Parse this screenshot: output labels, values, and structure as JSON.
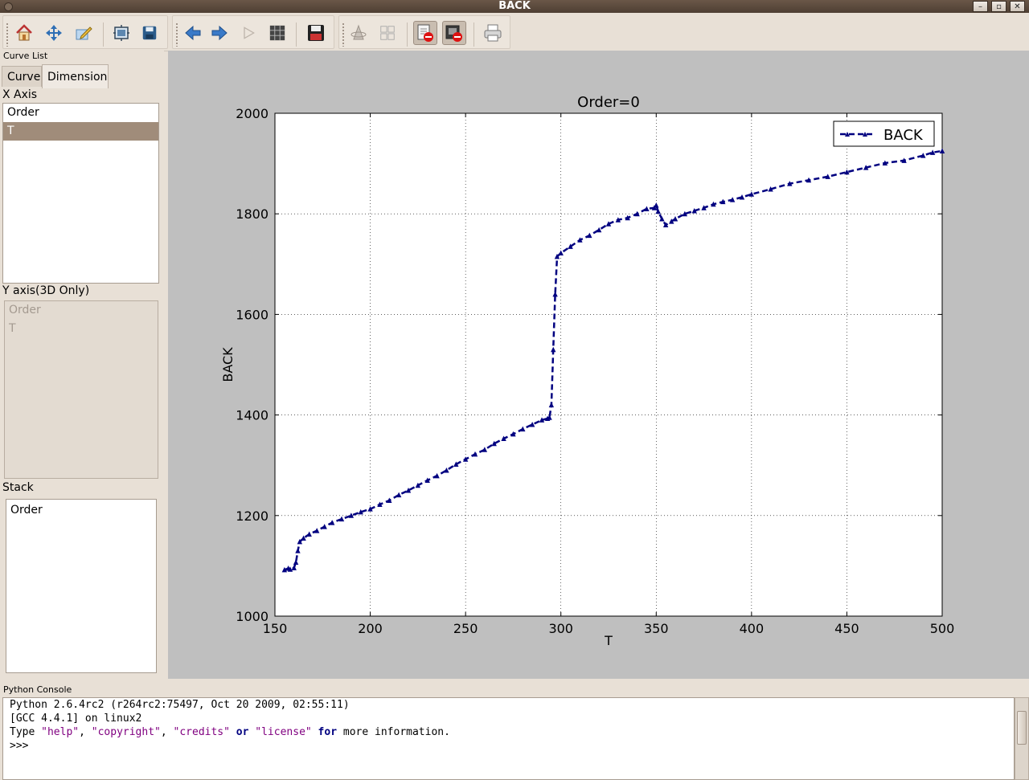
{
  "window": {
    "title": "BACK"
  },
  "toolbar": {
    "buttons": [
      "home-icon",
      "move-icon",
      "edit-icon",
      "configure-icon",
      "save-icon",
      "back-icon",
      "forward-icon",
      "play-icon",
      "grid-icon",
      "save-figure-icon",
      "rotate-3d-icon",
      "tile-icon",
      "remove-curve-icon",
      "remove-all-icon",
      "print-icon"
    ]
  },
  "curve_list": {
    "header": "Curve List",
    "tabs": [
      "Curve",
      "Dimension"
    ],
    "active_tab": "Dimension",
    "x_axis_label": "X Axis",
    "x_axis_items": [
      "Order",
      "T"
    ],
    "x_axis_selected": "T",
    "y_axis_label": "Y axis(3D Only)",
    "y_axis_items": [
      "Order",
      "T"
    ],
    "stack_label": "Stack",
    "stack_items": [
      "Order"
    ]
  },
  "chart_data": {
    "type": "line",
    "title": "Order=0",
    "xlabel": "T",
    "ylabel": "BACK",
    "xlim": [
      150,
      500
    ],
    "ylim": [
      1000,
      2000
    ],
    "xticks": [
      "150",
      "200",
      "250",
      "300",
      "350",
      "400",
      "450",
      "500"
    ],
    "yticks": [
      "1000",
      "1200",
      "1400",
      "1600",
      "1800",
      "2000"
    ],
    "grid": true,
    "legend": "top-right",
    "line_color": "#000080",
    "line_style": "dashed",
    "marker": "triangle",
    "series": [
      {
        "name": "BACK",
        "x": [
          155,
          157,
          158,
          160,
          161,
          162,
          163,
          165,
          168,
          172,
          176,
          180,
          185,
          190,
          195,
          200,
          205,
          210,
          215,
          220,
          225,
          230,
          235,
          240,
          245,
          250,
          255,
          260,
          265,
          270,
          275,
          280,
          285,
          290,
          293,
          294,
          295,
          296,
          297,
          298,
          300,
          305,
          310,
          315,
          320,
          325,
          330,
          335,
          340,
          345,
          349,
          350,
          351,
          353,
          355,
          358,
          360,
          365,
          370,
          375,
          380,
          385,
          390,
          395,
          400,
          410,
          420,
          430,
          440,
          450,
          460,
          470,
          480,
          490,
          495,
          500
        ],
        "y": [
          1092,
          1095,
          1093,
          1096,
          1107,
          1130,
          1148,
          1155,
          1163,
          1170,
          1178,
          1186,
          1193,
          1200,
          1207,
          1213,
          1222,
          1230,
          1241,
          1250,
          1260,
          1270,
          1279,
          1290,
          1302,
          1312,
          1322,
          1331,
          1343,
          1353,
          1362,
          1372,
          1381,
          1390,
          1393,
          1395,
          1420,
          1530,
          1640,
          1715,
          1722,
          1735,
          1748,
          1757,
          1768,
          1780,
          1788,
          1792,
          1800,
          1810,
          1812,
          1817,
          1805,
          1790,
          1778,
          1785,
          1790,
          1800,
          1806,
          1812,
          1819,
          1824,
          1828,
          1833,
          1839,
          1849,
          1860,
          1867,
          1874,
          1883,
          1892,
          1901,
          1906,
          1916,
          1922,
          1925
        ]
      }
    ]
  },
  "console": {
    "header": "Python Console",
    "line1": "Python 2.6.4rc2 (r264rc2:75497, Oct 20 2009, 02:55:11)",
    "line2": "[GCC 4.4.1] on linux2",
    "line3_type": "Type ",
    "line3_help": "\"help\"",
    "line3_comma1": ", ",
    "line3_copyright": "\"copyright\"",
    "line3_comma2": ", ",
    "line3_credits": "\"credits\"",
    "line3_or": " or ",
    "line3_license": "\"license\"",
    "line3_for": " for ",
    "line3_more": "more information.",
    "line4": ">>>"
  }
}
